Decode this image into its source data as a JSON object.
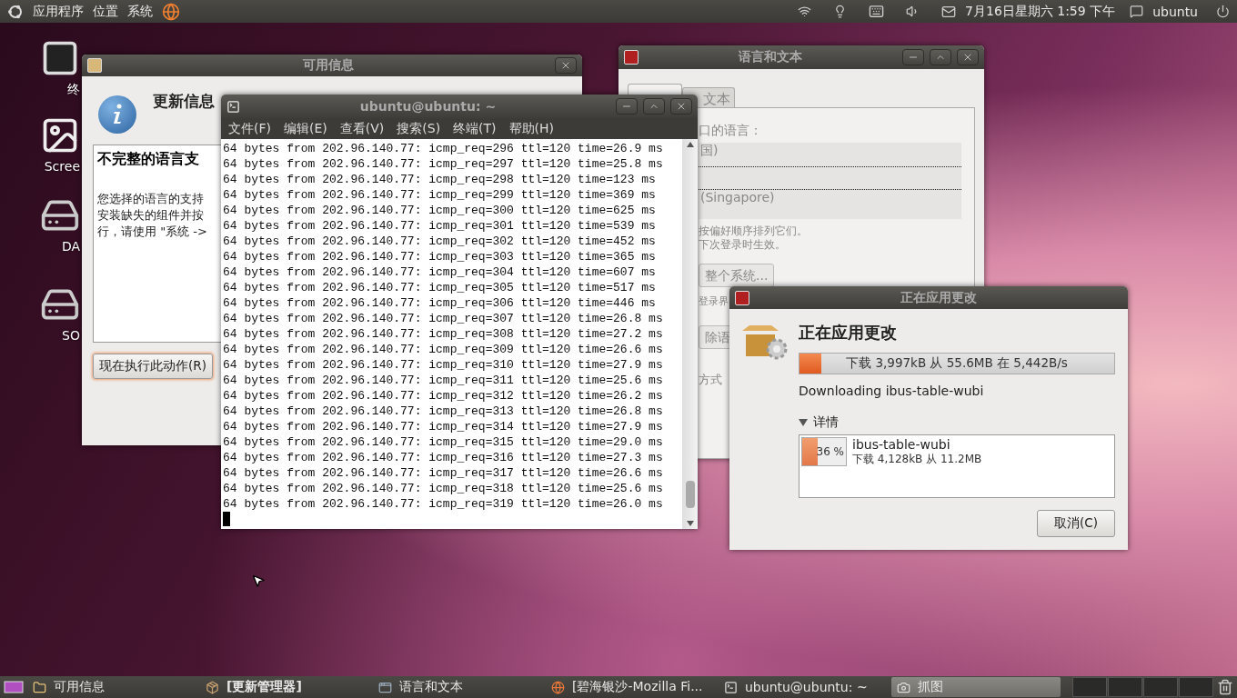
{
  "top_panel": {
    "menus": [
      "应用程序",
      "位置",
      "系统"
    ],
    "clock": "7月16日星期六 1:59 下午",
    "user": "ubuntu"
  },
  "desktop_icons": [
    {
      "kind": "terminal",
      "label": "终"
    },
    {
      "kind": "screenshot",
      "label": "Scree"
    },
    {
      "kind": "disk",
      "label": "DA"
    },
    {
      "kind": "disk",
      "label": "SO"
    }
  ],
  "info_window": {
    "title": "可用信息",
    "heading": "更新信息",
    "box_title": "不完整的语言支",
    "box_lines": [
      "您选择的语言的支持",
      "安装缺失的组件并按",
      "行，请使用 \"系统 -> "
    ],
    "action_button": "现在执行此动作(R)"
  },
  "language_window": {
    "title": "语言和文本",
    "tabs": [
      {
        "selected": true
      },
      {
        "label": "文本",
        "selected": false
      }
    ],
    "prompt": "口的语言：",
    "list": [
      "国)",
      "(Singapore)"
    ],
    "hints": [
      "按偏好顺序排列它们。",
      "下次登录时生效。"
    ],
    "system_button": "整个系统...",
    "login_text": "登录界",
    "remove_button": "除语",
    "method_text": "方式"
  },
  "terminal": {
    "title": "ubuntu@ubuntu: ~",
    "menus": [
      "文件(F)",
      "编辑(E)",
      "查看(V)",
      "搜索(S)",
      "终端(T)",
      "帮助(H)"
    ],
    "lines": [
      "64 bytes from 202.96.140.77: icmp_req=296 ttl=120 time=26.9 ms",
      "64 bytes from 202.96.140.77: icmp_req=297 ttl=120 time=25.8 ms",
      "64 bytes from 202.96.140.77: icmp_req=298 ttl=120 time=123 ms",
      "64 bytes from 202.96.140.77: icmp_req=299 ttl=120 time=369 ms",
      "64 bytes from 202.96.140.77: icmp_req=300 ttl=120 time=625 ms",
      "64 bytes from 202.96.140.77: icmp_req=301 ttl=120 time=539 ms",
      "64 bytes from 202.96.140.77: icmp_req=302 ttl=120 time=452 ms",
      "64 bytes from 202.96.140.77: icmp_req=303 ttl=120 time=365 ms",
      "64 bytes from 202.96.140.77: icmp_req=304 ttl=120 time=607 ms",
      "64 bytes from 202.96.140.77: icmp_req=305 ttl=120 time=517 ms",
      "64 bytes from 202.96.140.77: icmp_req=306 ttl=120 time=446 ms",
      "64 bytes from 202.96.140.77: icmp_req=307 ttl=120 time=26.8 ms",
      "64 bytes from 202.96.140.77: icmp_req=308 ttl=120 time=27.2 ms",
      "64 bytes from 202.96.140.77: icmp_req=309 ttl=120 time=26.6 ms",
      "64 bytes from 202.96.140.77: icmp_req=310 ttl=120 time=27.9 ms",
      "64 bytes from 202.96.140.77: icmp_req=311 ttl=120 time=25.6 ms",
      "64 bytes from 202.96.140.77: icmp_req=312 ttl=120 time=26.2 ms",
      "64 bytes from 202.96.140.77: icmp_req=313 ttl=120 time=26.8 ms",
      "64 bytes from 202.96.140.77: icmp_req=314 ttl=120 time=27.9 ms",
      "64 bytes from 202.96.140.77: icmp_req=315 ttl=120 time=29.0 ms",
      "64 bytes from 202.96.140.77: icmp_req=316 ttl=120 time=27.3 ms",
      "64 bytes from 202.96.140.77: icmp_req=317 ttl=120 time=26.6 ms",
      "64 bytes from 202.96.140.77: icmp_req=318 ttl=120 time=25.6 ms",
      "64 bytes from 202.96.140.77: icmp_req=319 ttl=120 time=26.0 ms"
    ]
  },
  "progress_dialog": {
    "title": "正在应用更改",
    "heading": "正在应用更改",
    "overall": {
      "level": 0.07,
      "text": "下载 3,997kB 从 55.6MB 在 5,442B/s"
    },
    "status": "Downloading ibus-table-wubi",
    "details": {
      "label": "详情",
      "expanded": true,
      "items": [
        {
          "level": 0.36,
          "percent": "36 %",
          "name": "ibus-table-wubi",
          "progress": "下载 4,128kB 从 11.2MB"
        }
      ]
    },
    "cancel_button": "取消(C)"
  },
  "taskbar": {
    "items": [
      {
        "kind": "folder",
        "label": "可用信息",
        "selected": false
      },
      {
        "kind": "package",
        "label": "[更新管理器]",
        "selected": false
      },
      {
        "kind": "window",
        "label": "语言和文本",
        "selected": false
      },
      {
        "kind": "browser",
        "label": "[碧海银沙-Mozilla Fi...",
        "selected": false
      },
      {
        "kind": "terminal",
        "label": "ubuntu@ubuntu: ~",
        "selected": false
      },
      {
        "kind": "camera",
        "label": "抓图",
        "selected": true
      }
    ]
  }
}
